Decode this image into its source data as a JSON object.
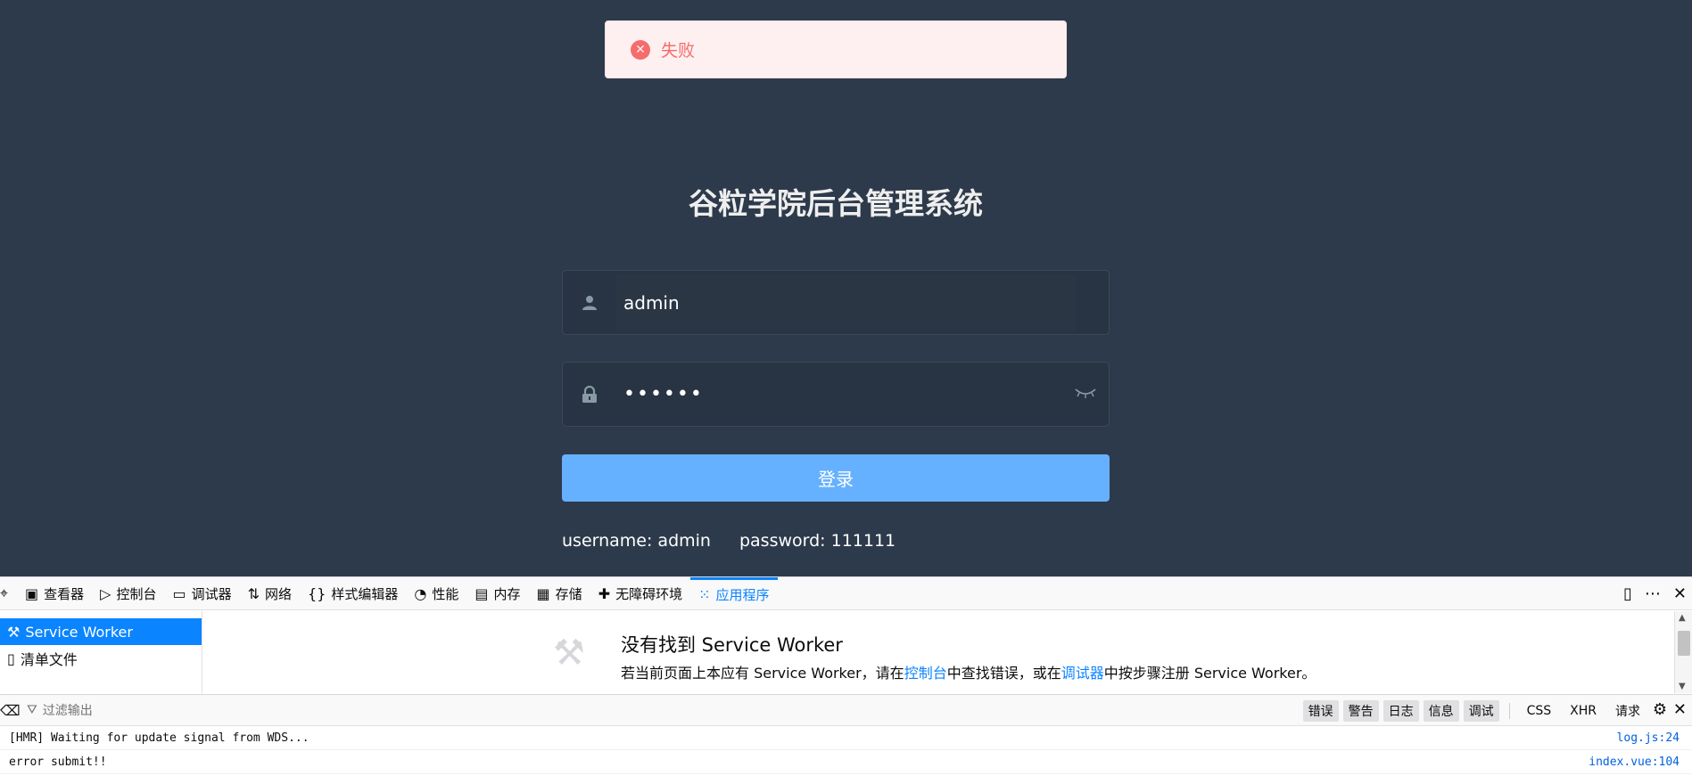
{
  "toast": {
    "icon": "close-circle-icon",
    "message": "失败"
  },
  "login": {
    "title": "谷粒学院后台管理系统",
    "username_value": "admin",
    "password_value": "••••••",
    "submit_label": "登录",
    "tip_username": "username: admin",
    "tip_password": "password: 111111"
  },
  "devtools": {
    "tabs": [
      {
        "label": "查看器",
        "icon": "inspector-icon"
      },
      {
        "label": "控制台",
        "icon": "console-icon"
      },
      {
        "label": "调试器",
        "icon": "debugger-icon"
      },
      {
        "label": "网络",
        "icon": "network-icon"
      },
      {
        "label": "样式编辑器",
        "icon": "style-editor-icon"
      },
      {
        "label": "性能",
        "icon": "performance-icon"
      },
      {
        "label": "内存",
        "icon": "memory-icon"
      },
      {
        "label": "存储",
        "icon": "storage-icon"
      },
      {
        "label": "无障碍环境",
        "icon": "accessibility-icon"
      },
      {
        "label": "应用程序",
        "icon": "application-icon",
        "active": true
      }
    ],
    "sidebar": [
      {
        "label": "Service Worker",
        "icon": "wrench-icon",
        "active": true
      },
      {
        "label": "清单文件",
        "icon": "file-icon"
      }
    ],
    "main": {
      "title": "没有找到 Service Worker",
      "desc_1": "若当前页面上本应有 Service Worker，请在",
      "link_console": "控制台",
      "desc_2": "中查找错误，或在",
      "link_debugger": "调试器",
      "desc_3": "中按步骤注册 Service Worker。"
    },
    "console": {
      "filter_placeholder": "过滤输出",
      "levels": [
        "错误",
        "警告",
        "日志",
        "信息",
        "调试"
      ],
      "types": [
        "CSS",
        "XHR",
        "请求"
      ],
      "messages": [
        {
          "text": "[HMR] Waiting for update signal from WDS...",
          "source": "log.js:24"
        },
        {
          "text": "error submit!!",
          "source": "index.vue:104"
        }
      ]
    }
  },
  "colors": {
    "background": "#2d3a4b",
    "button": "#66b1ff",
    "error": "#f56c6c",
    "accent": "#0a84ff"
  }
}
